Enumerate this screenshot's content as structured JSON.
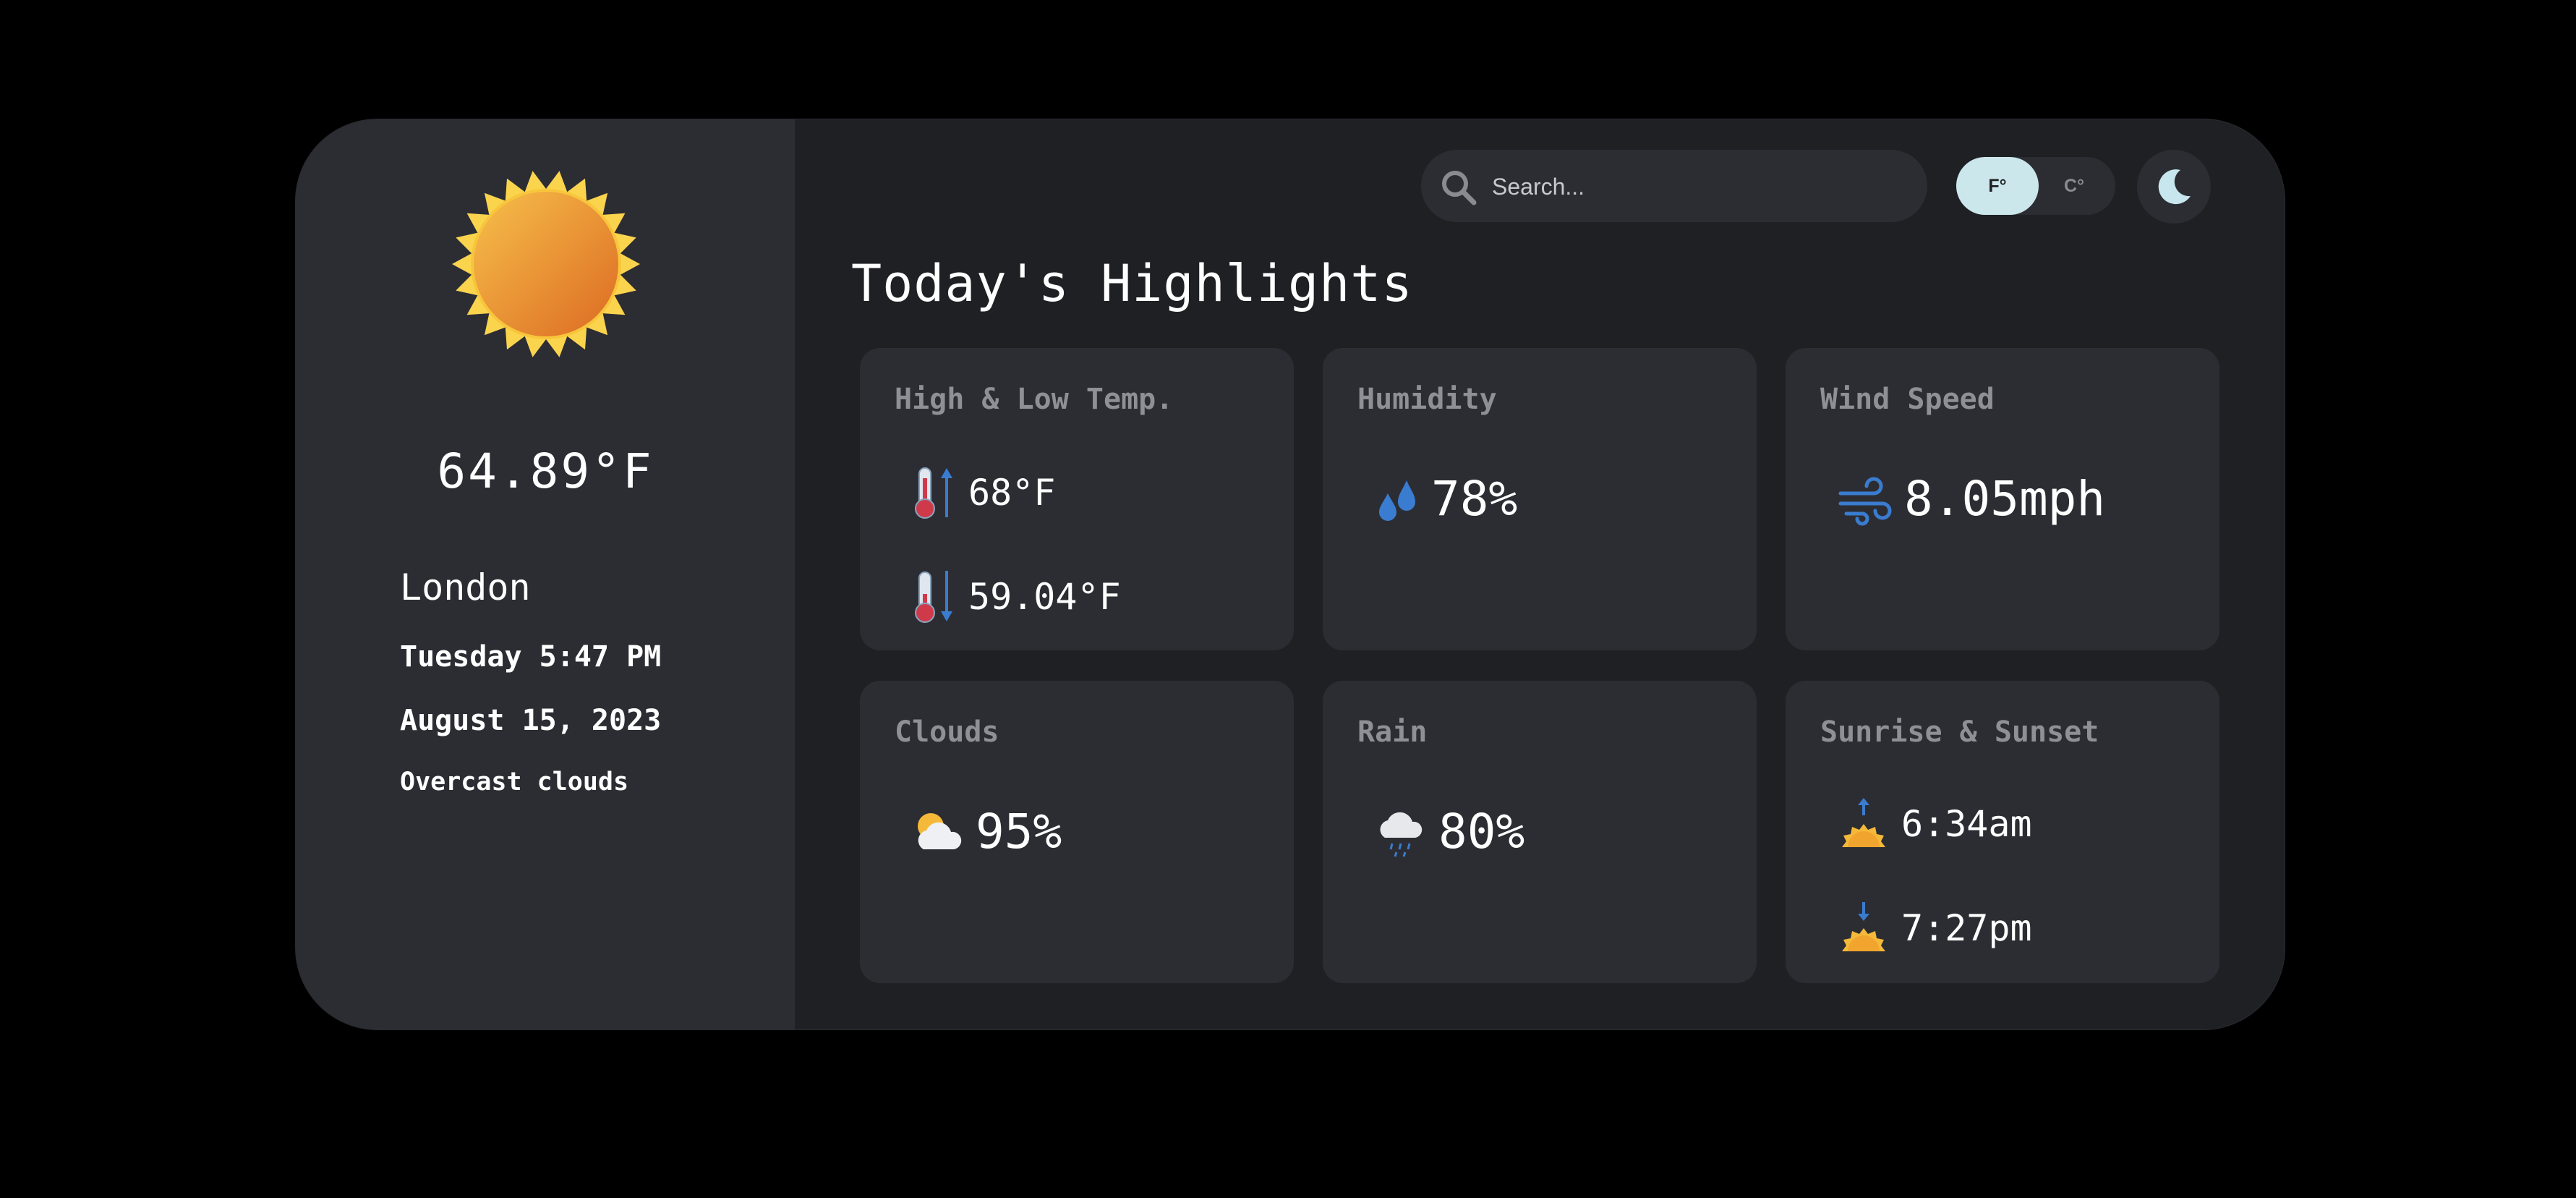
{
  "current": {
    "temperature": "64.89°F",
    "city": "London",
    "day_time": "Tuesday 5:47 PM",
    "date": "August 15, 2023",
    "description": "Overcast clouds",
    "icon": "sun-icon"
  },
  "header": {
    "search_placeholder": "Search...",
    "unit_f": "F°",
    "unit_c": "C°",
    "active_unit": "F°",
    "theme_icon": "moon-icon"
  },
  "highlights": {
    "title": "Today's Highlights",
    "temp": {
      "label": "High & Low Temp.",
      "high": "68°F",
      "low": "59.04°F"
    },
    "humidity": {
      "label": "Humidity",
      "value": "78%"
    },
    "wind": {
      "label": "Wind Speed",
      "value": "8.05mph"
    },
    "clouds": {
      "label": "Clouds",
      "value": "95%"
    },
    "rain": {
      "label": "Rain",
      "value": "80%"
    },
    "sun": {
      "label": "Sunrise & Sunset",
      "sunrise": "6:34am",
      "sunset": "7:27pm"
    }
  },
  "colors": {
    "background": "#000000",
    "panel": "#1f2024",
    "sidebar": "#2c2d33",
    "tile": "#2c2d33",
    "accent": "#cbe7ec",
    "label": "#8f9095",
    "icon_blue": "#3a7ccf"
  }
}
